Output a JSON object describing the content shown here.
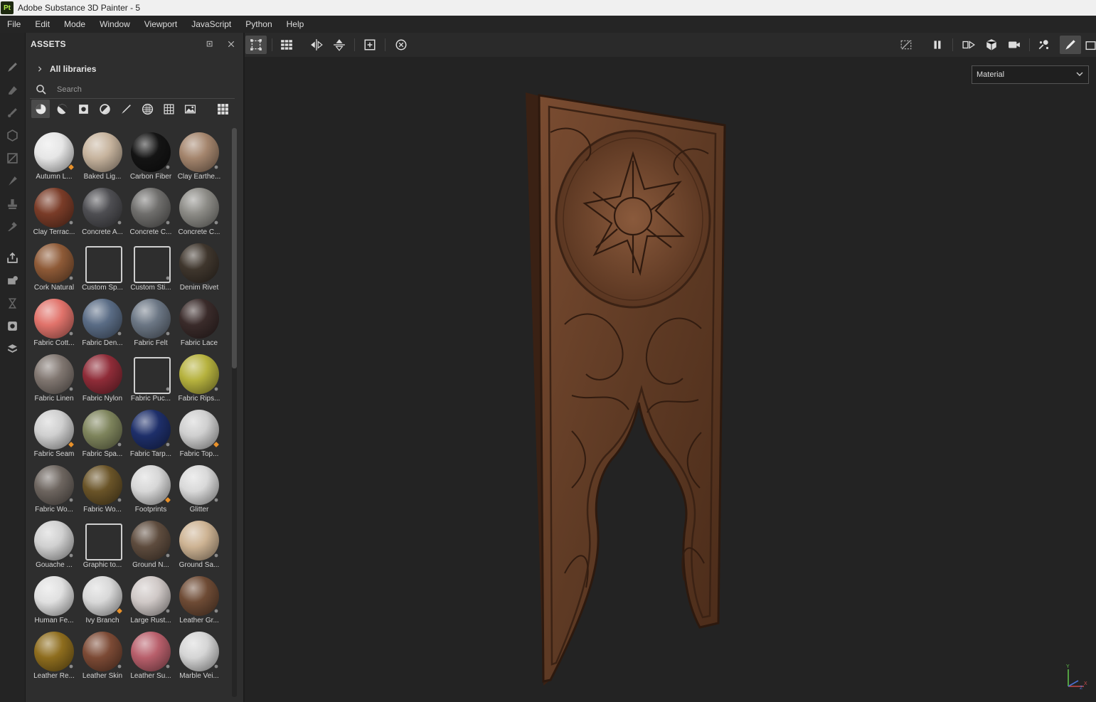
{
  "window": {
    "title": "Adobe Substance 3D Painter - 5",
    "logo_text": "Pt"
  },
  "menu": {
    "items": [
      "File",
      "Edit",
      "Mode",
      "Window",
      "Viewport",
      "JavaScript",
      "Python",
      "Help"
    ]
  },
  "left_toolbar": {
    "tools": [
      "paint-brush-icon",
      "eraser-icon",
      "projection-icon",
      "geometry-mask-icon",
      "polygon-fill-icon",
      "smudge-icon",
      "clone-stamp-icon",
      "color-picker-icon",
      "export-icon",
      "bake-icon",
      "history-icon",
      "display-settings-icon",
      "shelf-icon"
    ]
  },
  "assets": {
    "title": "ASSETS",
    "libraries_label": "All libraries",
    "search_placeholder": "Search",
    "filters": [
      "material-filter-icon",
      "smart-material-filter-icon",
      "texture-filter-icon",
      "procedural-filter-icon",
      "brush-filter-icon",
      "alpha-filter-icon",
      "pattern-filter-icon",
      "environment-filter-icon"
    ],
    "items": [
      {
        "label": "Autumn L...",
        "color": "#e6e6e6",
        "badge": "orange"
      },
      {
        "label": "Baked Lig...",
        "color": "#c6b39d",
        "badge": ""
      },
      {
        "label": "Carbon Fiber",
        "color": "#141414",
        "badge": "grey"
      },
      {
        "label": "Clay Earthe...",
        "color": "#a4856d",
        "badge": "grey"
      },
      {
        "label": "Clay Terrac...",
        "color": "#7a3c28",
        "badge": "grey"
      },
      {
        "label": "Concrete A...",
        "color": "#4e4e52",
        "badge": "grey"
      },
      {
        "label": "Concrete C...",
        "color": "#6f6e6c",
        "badge": "grey"
      },
      {
        "label": "Concrete C...",
        "color": "#8c8b86",
        "badge": "grey"
      },
      {
        "label": "Cork Natural",
        "color": "#8e5a37",
        "badge": "grey"
      },
      {
        "label": "Custom Sp...",
        "color": "#2e2e2e",
        "badge": ""
      },
      {
        "label": "Custom Sti...",
        "color": "#2e2e2e",
        "badge": "grey"
      },
      {
        "label": "Denim Rivet",
        "color": "#3f362d",
        "badge": ""
      },
      {
        "label": "Fabric Cott...",
        "color": "#e1736b",
        "badge": "grey"
      },
      {
        "label": "Fabric Den...",
        "color": "#5a6c85",
        "badge": "grey"
      },
      {
        "label": "Fabric Felt",
        "color": "#6b7684",
        "badge": "grey"
      },
      {
        "label": "Fabric Lace",
        "color": "#3a2b2a",
        "badge": ""
      },
      {
        "label": "Fabric Linen",
        "color": "#807670",
        "badge": "grey"
      },
      {
        "label": "Fabric Nylon",
        "color": "#8f2c38",
        "badge": ""
      },
      {
        "label": "Fabric Puc...",
        "color": "#2e2e2e",
        "badge": "grey"
      },
      {
        "label": "Fabric Rips...",
        "color": "#b6b23e",
        "badge": "grey"
      },
      {
        "label": "Fabric Seam",
        "color": "#cfcfcf",
        "badge": "orange"
      },
      {
        "label": "Fabric Spa...",
        "color": "#7e845c",
        "badge": "grey"
      },
      {
        "label": "Fabric Tarp...",
        "color": "#1e2f6a",
        "badge": "grey"
      },
      {
        "label": "Fabric Top...",
        "color": "#cfcfcf",
        "badge": "orange"
      },
      {
        "label": "Fabric Wo...",
        "color": "#6d655f",
        "badge": "grey"
      },
      {
        "label": "Fabric Wo...",
        "color": "#6a5428",
        "badge": "grey"
      },
      {
        "label": "Footprints",
        "color": "#d7d7d7",
        "badge": "orange"
      },
      {
        "label": "Glitter",
        "color": "#d9d9d9",
        "badge": "grey"
      },
      {
        "label": "Gouache ...",
        "color": "#d0d0d0",
        "badge": "grey"
      },
      {
        "label": "Graphic to...",
        "color": "#2e2e2e",
        "badge": ""
      },
      {
        "label": "Ground N...",
        "color": "#5e4c3e",
        "badge": "grey"
      },
      {
        "label": "Ground Sa...",
        "color": "#cdb393",
        "badge": "grey"
      },
      {
        "label": "Human Fe...",
        "color": "#e0e0e0",
        "badge": ""
      },
      {
        "label": "Ivy Branch",
        "color": "#d8d8d8",
        "badge": "orange"
      },
      {
        "label": "Large Rust...",
        "color": "#cfc8c6",
        "badge": "grey"
      },
      {
        "label": "Leather Gr...",
        "color": "#6e4b35",
        "badge": "grey"
      },
      {
        "label": "Leather Re...",
        "color": "#8e6d1e",
        "badge": "grey"
      },
      {
        "label": "Leather Skin",
        "color": "#7c4a35",
        "badge": "grey"
      },
      {
        "label": "Leather Su...",
        "color": "#b85f6b",
        "badge": "grey"
      },
      {
        "label": "Marble Vei...",
        "color": "#d5d5d5",
        "badge": "grey"
      }
    ]
  },
  "viewport": {
    "channel_value": "Material",
    "axis_labels": {
      "y": "Y",
      "x": "X",
      "z": "Z"
    },
    "left_tools": [
      "select-frame-icon",
      "tile-grid-icon",
      "symmetry-x-icon",
      "symmetry-y-icon",
      "center-frame-icon",
      "reset-camera-icon"
    ],
    "right_tools": [
      "hide-ui-icon",
      "pause-icon",
      "split-view-icon",
      "mesh-view-icon",
      "camera-icon",
      "physics-icon",
      "paint-mode-icon",
      "screenshot-icon"
    ],
    "colors": {
      "wood_dark": "#3a2114",
      "wood_mid": "#6b412a",
      "wood_light": "#8a5a3c"
    }
  }
}
